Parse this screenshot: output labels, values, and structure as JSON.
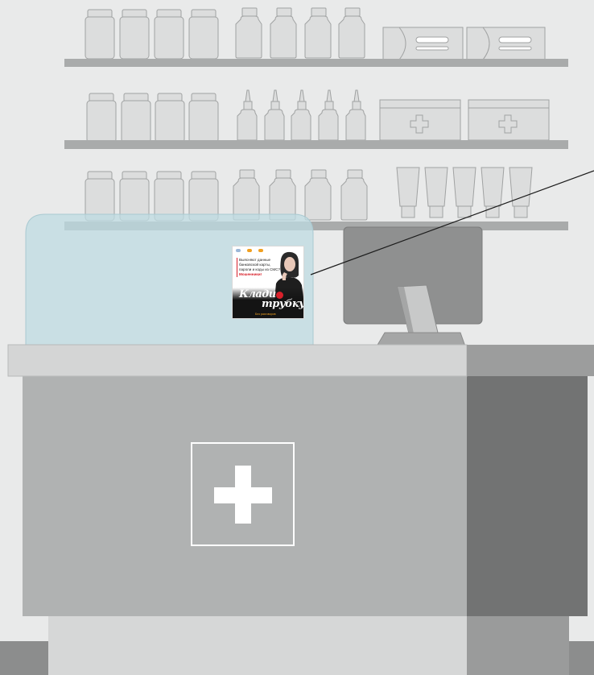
{
  "poster": {
    "lead_text": "Выясняют данные банковской карты, пароли и коды из СМС?",
    "warning_word": "Мошенники!",
    "slogan_line1": "Клади",
    "slogan_line2": "трубку",
    "footer_tag": "Без разговоров"
  },
  "colors": {
    "wall": "#e9eaea",
    "shelf": "#a9abab",
    "bottle_fill": "#dcdddd",
    "bottle_stroke": "#a0a2a2",
    "glass_screen": "#c8e0e6",
    "counter_top": "#d4d5d5",
    "counter_front": "#b0b2b2",
    "counter_side": "#727373",
    "monitor": "#8f9090",
    "cross": "#ffffff",
    "floor": "#8c8d8d"
  },
  "icons": {
    "counter_emblem": "medical-cross-icon",
    "box_emblem": "plus-icon"
  }
}
